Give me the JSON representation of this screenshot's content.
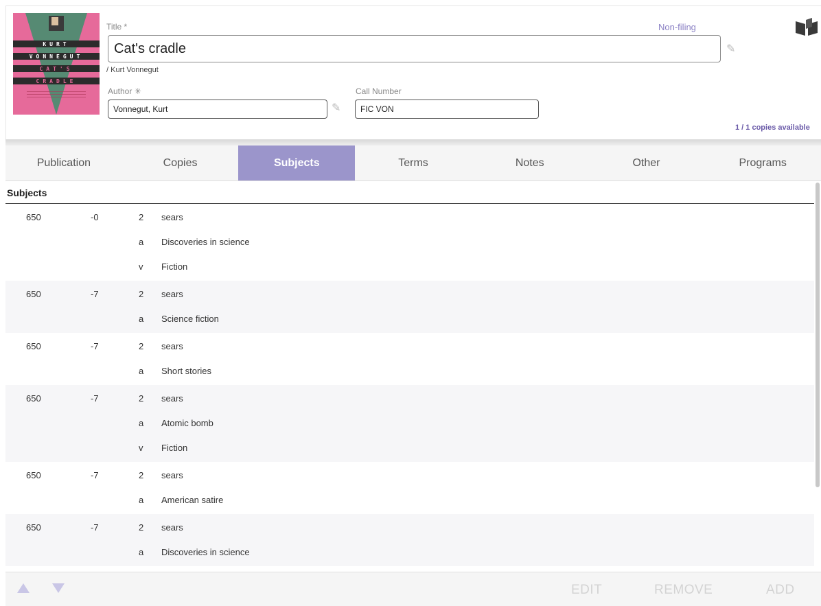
{
  "record": {
    "title_label": "Title *",
    "title_value": "Cat's cradle",
    "byline": "/ Kurt Vonnegut",
    "author_label": "Author ✳",
    "author_value": "Vonnegut, Kurt",
    "call_number_label": "Call Number",
    "call_number_value": "FIC VON",
    "nonfiling_label": "Non-filing",
    "copies_available": "1 / 1 copies available"
  },
  "cover": {
    "line1": "KURT",
    "line2": "VONNEGUT",
    "line3": "CAT'S",
    "line4": "CRADLE"
  },
  "tabs": [
    {
      "label": "Publication",
      "active": false
    },
    {
      "label": "Copies",
      "active": false
    },
    {
      "label": "Subjects",
      "active": true
    },
    {
      "label": "Terms",
      "active": false
    },
    {
      "label": "Notes",
      "active": false
    },
    {
      "label": "Other",
      "active": false
    },
    {
      "label": "Programs",
      "active": false
    }
  ],
  "subjects_header": "Subjects",
  "subjects": [
    {
      "tag": "650",
      "ind": "-0",
      "subfields": [
        [
          "2",
          "sears"
        ],
        [
          "a",
          "Discoveries in science"
        ],
        [
          "v",
          "Fiction"
        ]
      ]
    },
    {
      "tag": "650",
      "ind": "-7",
      "subfields": [
        [
          "2",
          "sears"
        ],
        [
          "a",
          "Science fiction"
        ]
      ]
    },
    {
      "tag": "650",
      "ind": "-7",
      "subfields": [
        [
          "2",
          "sears"
        ],
        [
          "a",
          "Short stories"
        ]
      ]
    },
    {
      "tag": "650",
      "ind": "-7",
      "subfields": [
        [
          "2",
          "sears"
        ],
        [
          "a",
          "Atomic bomb"
        ],
        [
          "v",
          "Fiction"
        ]
      ]
    },
    {
      "tag": "650",
      "ind": "-7",
      "subfields": [
        [
          "2",
          "sears"
        ],
        [
          "a",
          "American satire"
        ]
      ]
    },
    {
      "tag": "650",
      "ind": "-7",
      "subfields": [
        [
          "2",
          "sears"
        ],
        [
          "a",
          "Discoveries in science"
        ]
      ]
    }
  ],
  "footer": {
    "edit_label": "EDIT",
    "remove_label": "REMOVE",
    "add_label": "ADD"
  },
  "icons": {
    "book": "open-book-icon",
    "pencil": "pencil-icon",
    "up": "arrow-up-icon",
    "down": "arrow-down-icon"
  },
  "colors": {
    "accent": "#9b95cb",
    "link": "#8a80c4"
  }
}
